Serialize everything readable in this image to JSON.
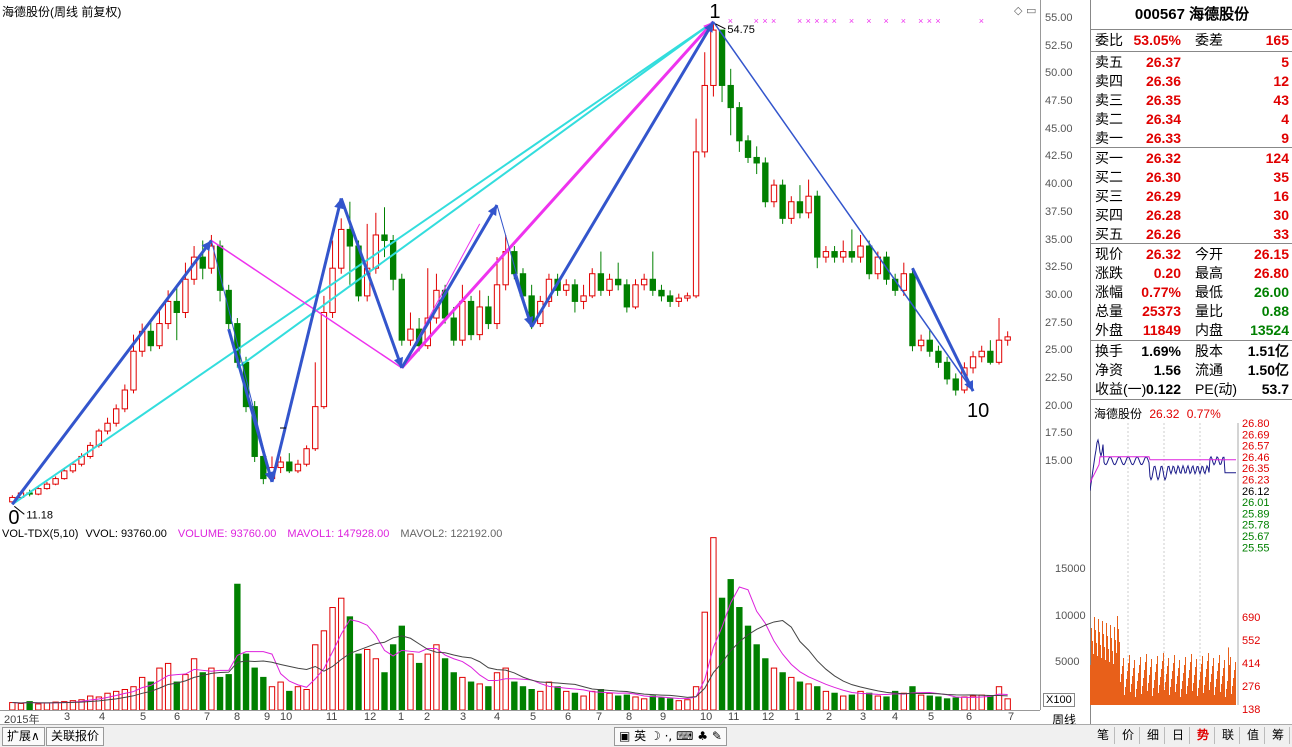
{
  "chart": {
    "title": "海德股份(周线 前复权)",
    "indicator_title": "VOL-TDX(5,10)",
    "vvol_label": "VVOL: 93760.00",
    "volume_label": "VOLUME: 93760.00",
    "mavol1_label": "MAVOL1: 147928.00",
    "mavol2_label": "MAVOL2: 122192.00",
    "high_marker": "54.75",
    "low_marker": "11.18",
    "wave_labels": [
      "0",
      "1",
      "10"
    ],
    "x100": "X100",
    "period": "周线",
    "colors": {
      "up": "#e00000",
      "down": "#008000",
      "cyan": "#33dddd",
      "magenta": "#ee33ee",
      "blue": "#3355cc",
      "mavol1": "#dd22dd",
      "mavol2": "#444444"
    }
  },
  "chart_data": {
    "type": "candlestick",
    "price_axis": [
      "55.00",
      "52.50",
      "50.00",
      "47.50",
      "45.00",
      "42.50",
      "40.00",
      "37.50",
      "35.00",
      "32.50",
      "30.00",
      "27.50",
      "25.00",
      "22.50",
      "20.00",
      "17.50",
      "15.00"
    ],
    "volume_axis": [
      "15000",
      "10000",
      "5000"
    ],
    "time_labels": [
      "2015年",
      "3",
      "4",
      "5",
      "6",
      "7",
      "8",
      "9",
      "10",
      "11",
      "12",
      "1",
      "2",
      "3",
      "4",
      "5",
      "6",
      "7",
      "8",
      "9",
      "10",
      "11",
      "12",
      "1",
      "2",
      "3",
      "4",
      "5",
      "6",
      "7"
    ],
    "ylim": [
      11,
      56
    ],
    "high": 54.75,
    "low": 11.18,
    "candles": [
      [
        11.4,
        11.8,
        11.2,
        12.0
      ],
      [
        11.8,
        12.2,
        11.7,
        12.4
      ],
      [
        12.2,
        12.1,
        11.9,
        12.5
      ],
      [
        12.1,
        12.6,
        12.0,
        12.8
      ],
      [
        12.6,
        13.0,
        12.5,
        13.2
      ],
      [
        13.0,
        13.5,
        12.9,
        13.7
      ],
      [
        13.5,
        14.2,
        13.4,
        14.4
      ],
      [
        14.2,
        14.8,
        14.0,
        15.0
      ],
      [
        14.8,
        15.5,
        14.6,
        15.8
      ],
      [
        15.5,
        16.5,
        15.3,
        16.8
      ],
      [
        16.5,
        17.8,
        16.3,
        18.0
      ],
      [
        17.8,
        18.5,
        17.5,
        19.0
      ],
      [
        18.5,
        19.8,
        18.2,
        20.2
      ],
      [
        19.8,
        21.5,
        19.5,
        22.0
      ],
      [
        21.5,
        25.0,
        21.2,
        26.5
      ],
      [
        25.0,
        26.8,
        24.5,
        27.5
      ],
      [
        26.8,
        25.5,
        25.0,
        27.8
      ],
      [
        25.5,
        27.5,
        25.2,
        29.0
      ],
      [
        27.5,
        29.5,
        27.0,
        30.5
      ],
      [
        29.5,
        28.5,
        26.0,
        31.0
      ],
      [
        28.5,
        31.5,
        28.0,
        33.0
      ],
      [
        31.5,
        33.5,
        31.0,
        34.5
      ],
      [
        33.5,
        32.5,
        31.5,
        35.0
      ],
      [
        32.5,
        34.5,
        32.0,
        35.5
      ],
      [
        34.5,
        30.5,
        29.5,
        35.0
      ],
      [
        30.5,
        27.5,
        27.0,
        31.0
      ],
      [
        27.5,
        24.0,
        23.5,
        28.0
      ],
      [
        24.0,
        20.0,
        19.5,
        24.5
      ],
      [
        20.0,
        15.5,
        15.0,
        20.5
      ],
      [
        15.5,
        13.5,
        13.0,
        16.0
      ],
      [
        13.5,
        14.5,
        13.2,
        15.5
      ],
      [
        14.5,
        15.0,
        14.0,
        15.5
      ],
      [
        15.0,
        14.2,
        14.0,
        15.8
      ],
      [
        14.2,
        14.8,
        14.0,
        15.2
      ],
      [
        14.8,
        16.2,
        14.6,
        16.5
      ],
      [
        16.2,
        20.0,
        16.0,
        24.0
      ],
      [
        20.0,
        28.5,
        19.8,
        30.0
      ],
      [
        28.5,
        32.5,
        28.0,
        35.0
      ],
      [
        32.5,
        36.0,
        32.0,
        37.0
      ],
      [
        36.0,
        34.5,
        31.0,
        38.5
      ],
      [
        34.5,
        30.0,
        29.5,
        35.0
      ],
      [
        30.0,
        32.5,
        29.5,
        36.5
      ],
      [
        32.5,
        35.5,
        32.0,
        37.5
      ],
      [
        35.5,
        35.0,
        33.5,
        38.0
      ],
      [
        35.0,
        31.5,
        30.5,
        35.5
      ],
      [
        31.5,
        26.0,
        25.5,
        32.0
      ],
      [
        26.0,
        27.0,
        25.5,
        28.5
      ],
      [
        27.0,
        25.5,
        25.0,
        28.0
      ],
      [
        25.5,
        28.0,
        25.2,
        32.5
      ],
      [
        28.0,
        30.5,
        27.5,
        32.0
      ],
      [
        30.5,
        28.0,
        27.5,
        31.0
      ],
      [
        28.0,
        26.0,
        25.5,
        29.0
      ],
      [
        26.0,
        29.5,
        25.5,
        31.0
      ],
      [
        29.5,
        26.5,
        26.0,
        30.0
      ],
      [
        26.5,
        29.0,
        26.0,
        30.5
      ],
      [
        29.0,
        27.5,
        27.0,
        30.0
      ],
      [
        27.5,
        31.0,
        27.0,
        33.5
      ],
      [
        31.0,
        34.0,
        30.5,
        35.5
      ],
      [
        34.0,
        32.0,
        31.5,
        34.5
      ],
      [
        32.0,
        30.0,
        29.5,
        32.5
      ],
      [
        30.0,
        27.5,
        27.0,
        31.0
      ],
      [
        27.5,
        29.5,
        27.2,
        30.0
      ],
      [
        29.5,
        31.5,
        29.0,
        32.0
      ],
      [
        31.5,
        30.5,
        30.0,
        32.0
      ],
      [
        30.5,
        31.0,
        30.0,
        31.5
      ],
      [
        31.0,
        29.5,
        28.5,
        31.5
      ],
      [
        29.5,
        30.0,
        28.8,
        31.0
      ],
      [
        30.0,
        32.0,
        29.8,
        32.5
      ],
      [
        32.0,
        30.5,
        30.0,
        34.0
      ],
      [
        30.5,
        31.5,
        30.0,
        32.0
      ],
      [
        31.5,
        31.0,
        30.5,
        33.0
      ],
      [
        31.0,
        29.0,
        28.5,
        31.5
      ],
      [
        29.0,
        31.0,
        28.8,
        31.5
      ],
      [
        31.0,
        31.5,
        30.5,
        32.0
      ],
      [
        31.5,
        30.5,
        30.0,
        34.0
      ],
      [
        30.5,
        30.0,
        29.5,
        31.0
      ],
      [
        30.0,
        29.5,
        29.0,
        30.5
      ],
      [
        29.5,
        29.8,
        29.0,
        30.2
      ],
      [
        29.8,
        30.0,
        29.5,
        30.3
      ],
      [
        30.0,
        43.0,
        29.8,
        46.0
      ],
      [
        43.0,
        49.0,
        42.5,
        52.0
      ],
      [
        49.0,
        54.0,
        48.0,
        54.75
      ],
      [
        54.0,
        49.0,
        47.5,
        54.0
      ],
      [
        49.0,
        47.0,
        44.5,
        50.5
      ],
      [
        47.0,
        44.0,
        43.0,
        47.5
      ],
      [
        44.0,
        42.5,
        42.0,
        44.5
      ],
      [
        42.5,
        42.0,
        41.0,
        43.5
      ],
      [
        42.0,
        38.5,
        38.0,
        42.5
      ],
      [
        38.5,
        40.0,
        38.0,
        40.5
      ],
      [
        40.0,
        37.0,
        36.5,
        40.5
      ],
      [
        37.0,
        38.5,
        36.5,
        39.0
      ],
      [
        38.5,
        37.5,
        37.0,
        40.0
      ],
      [
        37.5,
        39.0,
        37.0,
        40.5
      ],
      [
        39.0,
        33.5,
        32.5,
        39.5
      ],
      [
        33.5,
        34.0,
        33.0,
        34.5
      ],
      [
        34.0,
        33.5,
        33.0,
        34.5
      ],
      [
        33.5,
        34.0,
        33.0,
        35.0
      ],
      [
        34.0,
        33.5,
        33.0,
        36.0
      ],
      [
        33.5,
        34.5,
        33.0,
        35.5
      ],
      [
        34.5,
        32.0,
        31.5,
        35.0
      ],
      [
        32.0,
        33.5,
        31.5,
        34.0
      ],
      [
        33.5,
        31.5,
        31.0,
        34.0
      ],
      [
        31.5,
        30.5,
        30.0,
        32.0
      ],
      [
        30.5,
        32.0,
        30.0,
        33.0
      ],
      [
        32.0,
        25.5,
        25.0,
        32.5
      ],
      [
        25.5,
        26.0,
        25.0,
        26.5
      ],
      [
        26.0,
        25.0,
        24.5,
        27.0
      ],
      [
        25.0,
        24.0,
        23.5,
        25.5
      ],
      [
        24.0,
        22.5,
        22.0,
        24.5
      ],
      [
        22.5,
        21.5,
        21.0,
        23.0
      ],
      [
        21.5,
        23.5,
        21.2,
        24.0
      ],
      [
        23.5,
        24.5,
        23.0,
        25.0
      ],
      [
        24.5,
        25.0,
        24.0,
        25.5
      ],
      [
        25.0,
        24.0,
        23.8,
        26.0
      ],
      [
        24.0,
        26.0,
        23.8,
        28.0
      ],
      [
        26.0,
        26.3,
        25.5,
        26.8
      ]
    ],
    "volumes": [
      800,
      700,
      900,
      650,
      750,
      850,
      900,
      1000,
      1100,
      1500,
      1400,
      1800,
      2000,
      2200,
      2500,
      3500,
      3000,
      4500,
      5000,
      3000,
      3800,
      5500,
      4000,
      4500,
      3500,
      3800,
      13500,
      6000,
      4500,
      3500,
      2500,
      3000,
      2000,
      2500,
      2200,
      7000,
      8500,
      11000,
      12000,
      10000,
      6000,
      6500,
      5500,
      4000,
      7000,
      9000,
      6000,
      5000,
      6000,
      7000,
      5500,
      4000,
      3500,
      3000,
      2800,
      2500,
      4000,
      4500,
      3000,
      2500,
      2200,
      2000,
      3000,
      2500,
      2000,
      1800,
      1500,
      2000,
      2200,
      1800,
      1500,
      1600,
      1400,
      1200,
      1500,
      1300,
      1200,
      1000,
      1100,
      2500,
      10500,
      18500,
      12000,
      14000,
      11000,
      9000,
      7000,
      5500,
      4500,
      4000,
      3500,
      3000,
      2800,
      2500,
      2000,
      1800,
      1500,
      1600,
      2000,
      1800,
      1500,
      1400,
      2000,
      1800,
      2500,
      1600,
      1500,
      1400,
      1200,
      1300,
      1400,
      1500,
      1600,
      1500,
      2500,
      1200
    ]
  },
  "quote": {
    "code_name": "000567 海德股份",
    "weibi_label": "委比",
    "weibi": "53.05%",
    "weicha_label": "委差",
    "weicha": "165",
    "asks": [
      {
        "label": "卖五",
        "price": "26.37",
        "vol": "5"
      },
      {
        "label": "卖四",
        "price": "26.36",
        "vol": "12"
      },
      {
        "label": "卖三",
        "price": "26.35",
        "vol": "43"
      },
      {
        "label": "卖二",
        "price": "26.34",
        "vol": "4"
      },
      {
        "label": "卖一",
        "price": "26.33",
        "vol": "9"
      }
    ],
    "bids": [
      {
        "label": "买一",
        "price": "26.32",
        "vol": "124"
      },
      {
        "label": "买二",
        "price": "26.30",
        "vol": "35"
      },
      {
        "label": "买三",
        "price": "26.29",
        "vol": "16"
      },
      {
        "label": "买四",
        "price": "26.28",
        "vol": "30"
      },
      {
        "label": "买五",
        "price": "26.26",
        "vol": "33"
      }
    ],
    "stats": [
      {
        "l1": "现价",
        "v1": "26.32",
        "c1": "red",
        "l2": "今开",
        "v2": "26.15",
        "c2": "red"
      },
      {
        "l1": "涨跌",
        "v1": "0.20",
        "c1": "red",
        "l2": "最高",
        "v2": "26.80",
        "c2": "red"
      },
      {
        "l1": "涨幅",
        "v1": "0.77%",
        "c1": "red",
        "l2": "最低",
        "v2": "26.00",
        "c2": "green"
      },
      {
        "l1": "总量",
        "v1": "25373",
        "c1": "red",
        "l2": "量比",
        "v2": "0.88",
        "c2": "green"
      },
      {
        "l1": "外盘",
        "v1": "11849",
        "c1": "red",
        "l2": "内盘",
        "v2": "13524",
        "c2": "green"
      }
    ],
    "fund": [
      {
        "l1": "换手",
        "v1": "1.69%",
        "l2": "股本",
        "v2": "1.51亿"
      },
      {
        "l1": "净资",
        "v1": "1.56",
        "l2": "流通",
        "v2": "1.50亿"
      },
      {
        "l1": "收益(一)",
        "v1": "0.122",
        "l2": "PE(动)",
        "v2": "53.7"
      }
    ]
  },
  "intraday": {
    "name": "海德股份",
    "price": "26.32",
    "pct": "0.77%",
    "price_ticks": [
      "26.80",
      "26.69",
      "26.57",
      "26.46",
      "26.35",
      "26.23",
      "26.12",
      "26.01",
      "25.89",
      "25.78",
      "25.67",
      "25.55"
    ],
    "vol_ticks": [
      "690",
      "552",
      "414",
      "276",
      "138"
    ]
  },
  "bottom": {
    "expand_btn": "扩展∧",
    "related_btn": "关联报价",
    "right_tabs": [
      "笔",
      "价",
      "细",
      "日",
      "势",
      "联",
      "值",
      "筹"
    ],
    "active_tab": "势"
  }
}
